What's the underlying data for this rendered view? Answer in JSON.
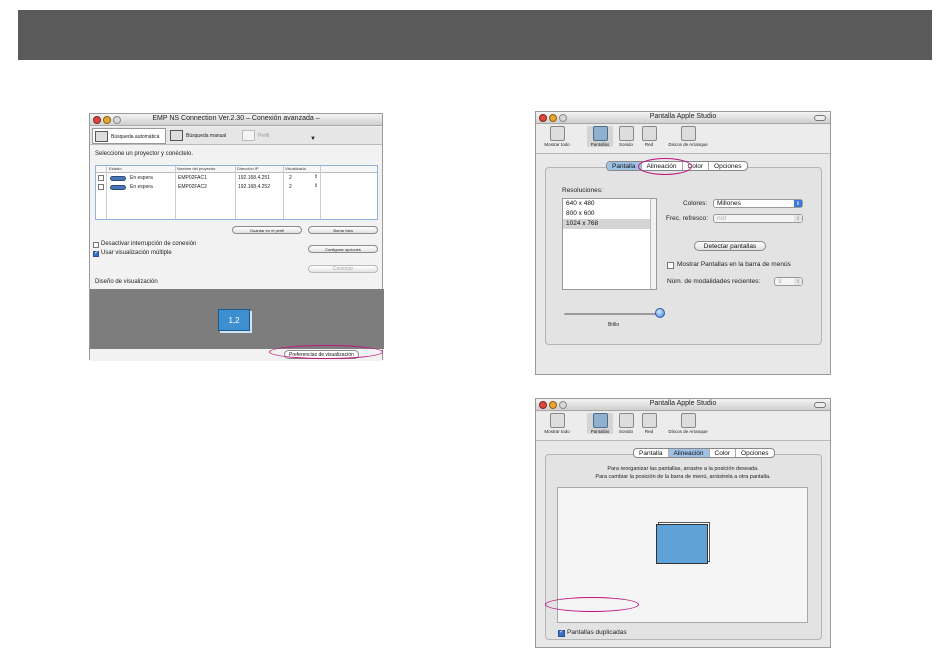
{
  "emp": {
    "title": "EMP NS Connection Ver.2.30  – Conexión avanzada –",
    "tabs": [
      "Búsqueda automática",
      "Búsqueda manual",
      "Perfil"
    ],
    "instruction": "Seleccione un proyector y conéctelo.",
    "table": {
      "headers": [
        "Estado",
        "Nombre del proyector",
        "Dirección IP",
        "Visualizació"
      ],
      "rows": [
        {
          "status": "En espera",
          "name": "EMP02FAC1",
          "ip": "192.168.4.251",
          "display": "2"
        },
        {
          "status": "En espera",
          "name": "EMP02FAC2",
          "ip": "192.168.4.252",
          "display": "2"
        }
      ]
    },
    "save_profile": "Guardar en el perfil",
    "clear_list": "Borrar lista",
    "disable_interrupt": "Desactivar interrupción de conexión",
    "multi_display": "Usar visualización múltiple",
    "config_options": "Configurar opciones",
    "connect": "Conectar",
    "layout_label": "Diseño de visualización",
    "display_box": "1,2",
    "display_prefs": "Preferencias de visualización"
  },
  "studio1": {
    "title": "Pantalla Apple Studio",
    "toolbar": [
      "Mostrar todo",
      "Pantallas",
      "Sonido",
      "Red",
      "Discos de Arranque"
    ],
    "tabs": [
      "Pantalla",
      "Alineación",
      "Color",
      "Opciones"
    ],
    "resolutions_label": "Resoluciones:",
    "resolutions": [
      "640 x 480",
      "800 x 600",
      "1024 x 768"
    ],
    "colors_label": "Colores:",
    "colors_value": "Millones",
    "refresh_label": "Frec. refresco:",
    "refresh_value": "n/d",
    "detect": "Detectar pantallas",
    "show_menu": "Mostrar Pantallas en la barra de menús",
    "recent_label": "Núm. de modalidades recientes:",
    "recent_value": "3",
    "brightness": "Brillo"
  },
  "studio2": {
    "title": "Pantalla Apple Studio",
    "toolbar": [
      "Mostrar todo",
      "Pantallas",
      "Sonido",
      "Red",
      "Discos de Arranque"
    ],
    "tabs": [
      "Pantalla",
      "Alineación",
      "Color",
      "Opciones"
    ],
    "instr1": "Para reorganizar las pantallas, arrastre a la posición deseada.",
    "instr2": "Para cambiar la posición de la barra de menú, arrástrela a otra pantalla.",
    "mirror": "Pantallas duplicadas"
  },
  "colors": {
    "accent": "#3b7ad4",
    "highlight": "#c0157f",
    "header": "#5a5a5a"
  }
}
